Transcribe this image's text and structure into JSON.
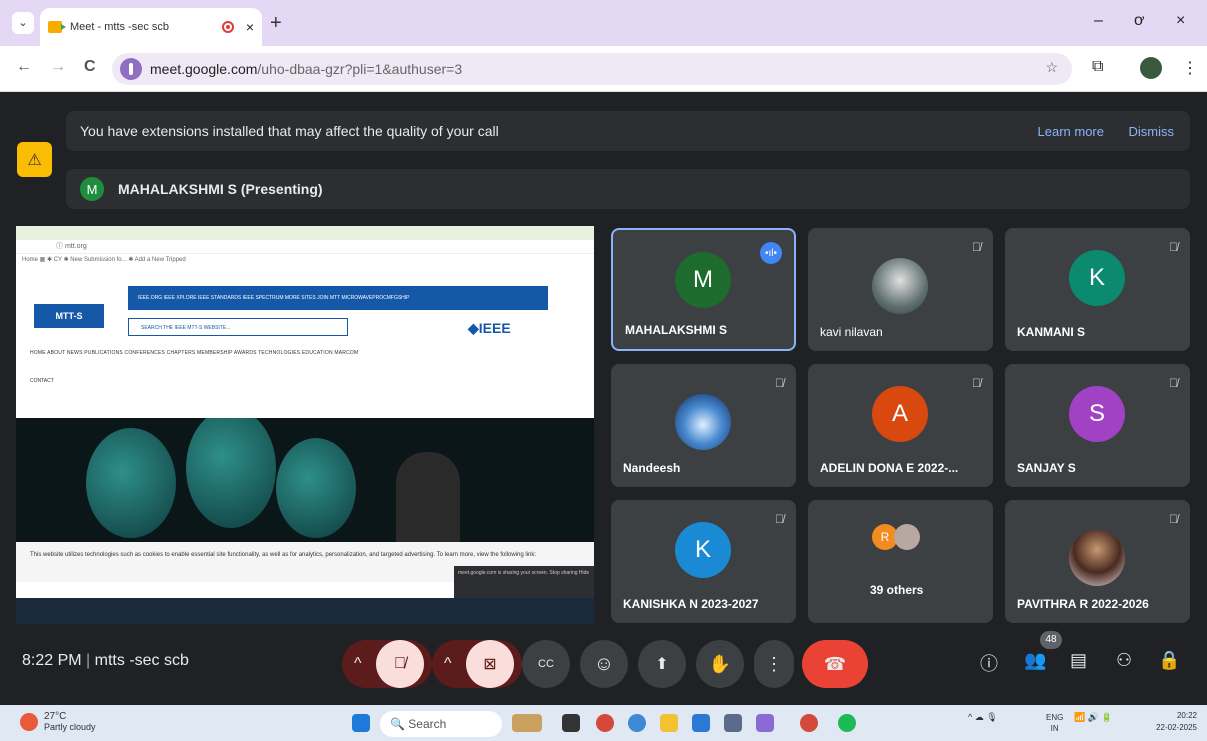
{
  "browser": {
    "tab_title": "Meet - mtts -sec scb",
    "close_glyph": "×",
    "newtab_glyph": "+",
    "minimize_glyph": "–",
    "maximize_glyph": "ơ",
    "window_close_glyph": "×",
    "url_host": "meet.google.com",
    "url_path": "/uho-dbaa-gzr?pli=1&authuser=3",
    "back": "←",
    "forward": "→",
    "reload": "C",
    "star": "☆",
    "menu": "⋮",
    "tabs_chevron": "⌄"
  },
  "notice": {
    "text": "You have extensions installed that may affect the quality of your call",
    "learn_more": "Learn more",
    "dismiss": "Dismiss"
  },
  "presenting": {
    "initial": "M",
    "label": "MAHALAKSHMI S (Presenting)"
  },
  "shared_screen": {
    "addr": "ⓘ mtt.org",
    "bookmarks": "Home  ▦  ✱ CY   ✱ New Submission fo...  ✱ Add a New Tripped",
    "ieee_topnav": "IEEE.ORG    IEEE XPLORE    IEEE STANDARDS    IEEE SPECTRUM    MORE SITES    JOIN MTT                        MICROWAVEPROCMFGSHIP",
    "logo": "MTT-S",
    "search": "SEARCH THE IEEE MTT-S WEBSITE...",
    "brand": "◆IEEE",
    "nav": "HOME   ABOUT   NEWS   PUBLICATIONS   CONFERENCES   CHAPTERS   MEMBERSHIP   AWARDS   TECHNOLOGIES   EDUCATION   MARCOM",
    "contact": "CONTACT",
    "cookie": "This website utilizes technologies such as cookies to enable essential site functionality, as well as for analytics, personalization, and targeted advertising. To learn more, view the following link:",
    "notif": "meet.google.com is sharing your screen.   Stop sharing   Hide"
  },
  "participants": [
    {
      "name": "MAHALAKSHMI S",
      "initial": "M",
      "color": "#1e6b2e"
    },
    {
      "name": "kavi nilavan",
      "initial": "",
      "color": ""
    },
    {
      "name": "KANMANI S",
      "initial": "K",
      "color": "#0b8a6f"
    },
    {
      "name": "Nandeesh",
      "initial": "",
      "color": ""
    },
    {
      "name": "ADELIN DONA E 2022-...",
      "initial": "A",
      "color": "#d9480f"
    },
    {
      "name": "SANJAY S",
      "initial": "S",
      "color": "#a142c4"
    },
    {
      "name": "KANISHKA N 2023-2027",
      "initial": "K",
      "color": "#1a8ad4"
    },
    {
      "name": "39 others",
      "initial": "R",
      "color": "#f28b20"
    },
    {
      "name": "PAVITHRA R 2022-2026",
      "initial": "",
      "color": ""
    }
  ],
  "icons": {
    "mic_off": "🎙̸",
    "talking": "•ıl•"
  },
  "controls": {
    "meeting_time": "8:22 PM",
    "meeting_name": "mtts -sec scb",
    "participant_count": "48",
    "captions": "CC",
    "emoji": "☺",
    "present": "⬆",
    "raise_hand": "✋",
    "more": "⋮",
    "leave": "☎",
    "caret": "^",
    "info": "ⓘ",
    "people": "👥",
    "chat": "▤",
    "activities": "⚇",
    "lock": "🔒"
  },
  "taskbar": {
    "temp": "27°C",
    "weather": "Partly cloudy",
    "search": "Search",
    "lang_top": "ENG",
    "lang_bottom": "IN",
    "time": "20:22",
    "date": "22-02-2025",
    "tray": "^  ☁  🎙",
    "net": "📶 🔊 🔋"
  }
}
